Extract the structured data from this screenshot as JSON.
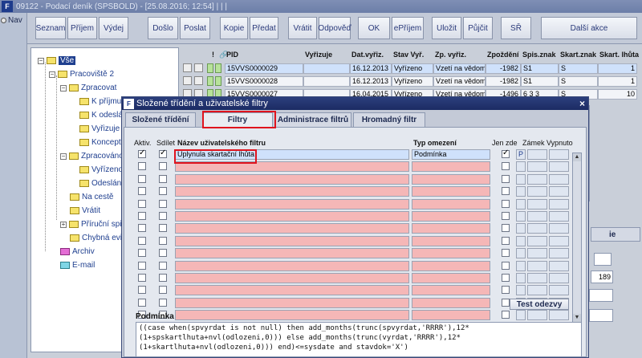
{
  "window": {
    "title": "09122 - Podací deník (SPSBOLD) - [25.08.2016; 12:54] | | |"
  },
  "nav": {
    "label": "Nav"
  },
  "toolbar": {
    "buttons": [
      "Seznam",
      "Příjem",
      "Výdej",
      "Došlo",
      "Poslat",
      "Kopie",
      "Předat",
      "Vrátit",
      "Odpověď",
      "OK",
      "ePříjem",
      "Uložit",
      "Půjčit",
      "SŘ",
      "Další akce"
    ]
  },
  "tree": {
    "root": "Vše",
    "items": [
      "Pracoviště 2",
      "Zpracovat",
      "K příjmu",
      "K odeslání",
      "Vyřizuje",
      "Koncepty",
      "Zpracováno",
      "Vyřízeno",
      "Odesláno",
      "Na cestě",
      "Vrátit",
      "Příruční spisov",
      "Chybná evide",
      "Archiv",
      "E-mail"
    ]
  },
  "grid": {
    "headers": [
      "!",
      "PID",
      "Vyřizuje",
      "Dat.vyřiz.",
      "Stav Vyř.",
      "Zp. vyřiz.",
      "Zpoždění",
      "Spis.znak",
      "Skart.znak",
      "Skart. lhůta"
    ],
    "rows": [
      [
        "15VVS0000029",
        "",
        "16.12.2013",
        "Vyřízeno",
        "Vzetí na vědomí",
        "-1982",
        "S1",
        "S",
        "1"
      ],
      [
        "15VVS0000028",
        "",
        "16.12.2013",
        "Vyřízeno",
        "Vzetí na vědomí",
        "-1982",
        "S1",
        "S",
        "1"
      ],
      [
        "15VVS0000027",
        "",
        "16.04.2015",
        "Vyřízeno",
        "Vzetí na vědomí",
        "-1496",
        "6 3 3",
        "S",
        "10"
      ]
    ],
    "right_value": "189",
    "right_tab": "ie"
  },
  "modal": {
    "title": "Složené třídění a uživatelské filtry",
    "close": "×",
    "tabs": [
      "Složené třídění",
      "Filtry",
      "Administrace filtrů",
      "Hromadný filtr"
    ],
    "columns": {
      "aktiv": "Aktiv.",
      "sdilet": "Sdílet",
      "name": "Název uživatelského filtru",
      "type": "Typ omezení",
      "jen_zde": "Jen zde",
      "zamek": "Zámek",
      "vypnuto": "Vypnuto"
    },
    "first_row": {
      "name": "Uplynula skartační lhůta",
      "type": "Podmínka",
      "zamek": "P"
    },
    "test_button": "Test odezvy",
    "condition_label": "Podmínka",
    "condition_text": "((case when(spvyrdat is not null) then add_months(trunc(spvyrdat,'RRRR'),12*(1+spskartlhuta+nvl(odlozeni,0))) else add_months(trunc(vyrdat,'RRRR'),12*(1+skartlhuta+nvl(odlozeni,0))) end)<=sysdate and stavdok='X')"
  },
  "colors": {
    "accent": "#1f3f8f",
    "highlight": "#e0141e",
    "empty_row": "#f5b7b7",
    "selected_row": "#cfe1fb"
  }
}
